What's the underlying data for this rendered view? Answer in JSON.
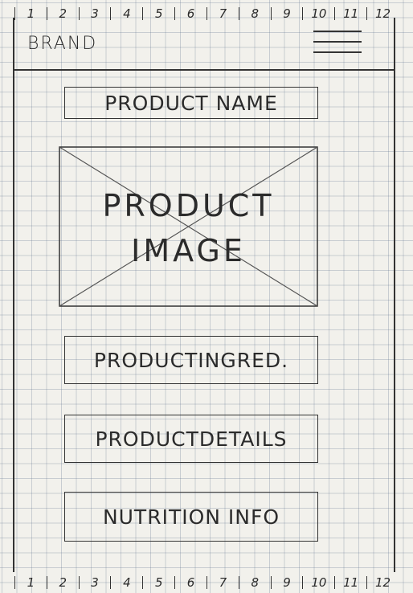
{
  "ruler_top": [
    "1",
    "2",
    "3",
    "4",
    "5",
    "6",
    "7",
    "8",
    "9",
    "10",
    "11",
    "12"
  ],
  "ruler_bottom": [
    "1",
    "2",
    "3",
    "4",
    "5",
    "6",
    "7",
    "8",
    "9",
    "10",
    "11",
    "12"
  ],
  "header": {
    "brand": "BRAND",
    "menu_icon": "hamburger-menu-icon"
  },
  "product": {
    "name": "PRODUCT NAME",
    "image_label": "PRODUCT\nIMAGE",
    "ingredients": "PRODUCTINGRED.",
    "details": "PRODUCTDETAILS",
    "nutrition": "NUTRITION INFO"
  }
}
